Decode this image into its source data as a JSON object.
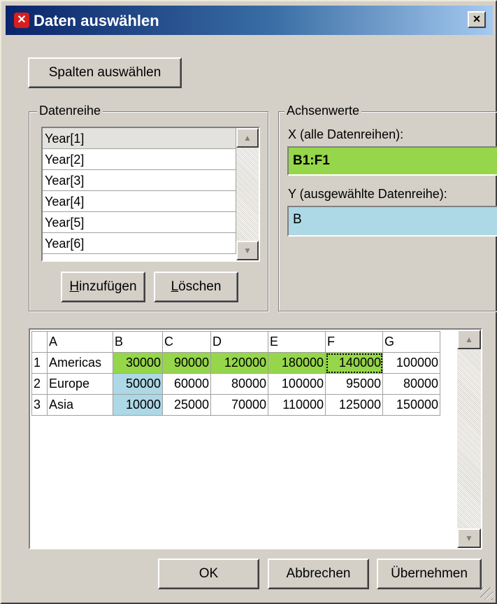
{
  "window": {
    "title": "Daten auswählen",
    "close_label": "×"
  },
  "toolbar": {
    "select_columns_label": "Spalten auswählen"
  },
  "series_group": {
    "label": "Datenreihe",
    "items": [
      "Year[1]",
      "Year[2]",
      "Year[3]",
      "Year[4]",
      "Year[5]",
      "Year[6]"
    ],
    "selected_index": 0,
    "add_label_mnemonic": "H",
    "add_label_rest": "inzufügen",
    "delete_label_mnemonic": "L",
    "delete_label_rest": "öschen"
  },
  "axis_group": {
    "label": "Achsenwerte",
    "x_label": "X (alle Datenreihen):",
    "x_value": "B1:F1",
    "y_label": "Y (ausgewählte Datenreihe):",
    "y_value": "B",
    "x_color": "#95d64a",
    "y_color": "#add8e6"
  },
  "sheet": {
    "columns": [
      "A",
      "B",
      "C",
      "D",
      "E",
      "F",
      "G"
    ],
    "rows": [
      {
        "num": "1",
        "cells": [
          "Americas",
          "30000",
          "90000",
          "120000",
          "180000",
          "140000",
          "100000"
        ]
      },
      {
        "num": "2",
        "cells": [
          "Europe",
          "50000",
          "60000",
          "80000",
          "100000",
          "95000",
          "80000"
        ]
      },
      {
        "num": "3",
        "cells": [
          "Asia",
          "10000",
          "25000",
          "70000",
          "110000",
          "125000",
          "150000"
        ]
      }
    ]
  },
  "footer": {
    "ok_label": "OK",
    "cancel_label": "Abbrechen",
    "apply_label": "Übernehmen"
  }
}
